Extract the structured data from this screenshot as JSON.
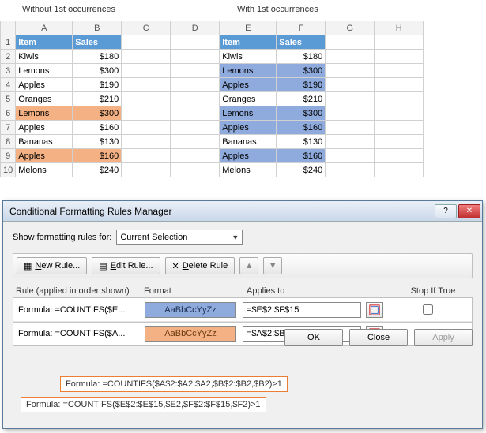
{
  "captions": {
    "without": "Without 1st occurrences",
    "with": "With 1st occurrences"
  },
  "columns": [
    "A",
    "B",
    "C",
    "D",
    "E",
    "F",
    "G",
    "H"
  ],
  "rows": [
    "1",
    "2",
    "3",
    "4",
    "5",
    "6",
    "7",
    "8",
    "9",
    "10"
  ],
  "left": {
    "headers": {
      "item": "Item",
      "sales": "Sales"
    },
    "data": [
      {
        "item": "Kiwis",
        "sales": "$180",
        "hl": ""
      },
      {
        "item": "Lemons",
        "sales": "$300",
        "hl": ""
      },
      {
        "item": "Apples",
        "sales": "$190",
        "hl": ""
      },
      {
        "item": "Oranges",
        "sales": "$210",
        "hl": ""
      },
      {
        "item": "Lemons",
        "sales": "$300",
        "hl": "org"
      },
      {
        "item": "Apples",
        "sales": "$160",
        "hl": ""
      },
      {
        "item": "Bananas",
        "sales": "$130",
        "hl": ""
      },
      {
        "item": "Apples",
        "sales": "$160",
        "hl": "org"
      },
      {
        "item": "Melons",
        "sales": "$240",
        "hl": ""
      }
    ]
  },
  "right": {
    "headers": {
      "item": "Item",
      "sales": "Sales"
    },
    "data": [
      {
        "item": "Kiwis",
        "sales": "$180",
        "hl": ""
      },
      {
        "item": "Lemons",
        "sales": "$300",
        "hl": "blue"
      },
      {
        "item": "Apples",
        "sales": "$190",
        "hl": "blue"
      },
      {
        "item": "Oranges",
        "sales": "$210",
        "hl": ""
      },
      {
        "item": "Lemons",
        "sales": "$300",
        "hl": "blue"
      },
      {
        "item": "Apples",
        "sales": "$160",
        "hl": "blue"
      },
      {
        "item": "Bananas",
        "sales": "$130",
        "hl": ""
      },
      {
        "item": "Apples",
        "sales": "$160",
        "hl": "blue"
      },
      {
        "item": "Melons",
        "sales": "$240",
        "hl": ""
      }
    ]
  },
  "dialog": {
    "title": "Conditional Formatting Rules Manager",
    "show_label": "Show formatting rules for:",
    "scope": "Current Selection",
    "buttons": {
      "new": "New Rule...",
      "edit": "Edit Rule...",
      "delete": "Delete Rule"
    },
    "list_headers": {
      "rule": "Rule (applied in order shown)",
      "format": "Format",
      "applies": "Applies to",
      "stop": "Stop If True"
    },
    "rules": [
      {
        "text": "Formula: =COUNTIFS($E...",
        "swatch": "blue",
        "sample": "AaBbCcYyZz",
        "applies": "=$E$2:$F$15"
      },
      {
        "text": "Formula: =COUNTIFS($A...",
        "swatch": "org",
        "sample": "AaBbCcYyZz",
        "applies": "=$A$2:$B$15"
      }
    ],
    "callouts": {
      "c1": "Formula: =COUNTIFS($A$2:$A2,$A2,$B$2:$B2,$B2)>1",
      "c2": "Formula: =COUNTIFS($E$2:$E$15,$E2,$F$2:$F$15,$F2)>1"
    },
    "footer": {
      "ok": "OK",
      "close": "Close",
      "apply": "Apply"
    }
  }
}
